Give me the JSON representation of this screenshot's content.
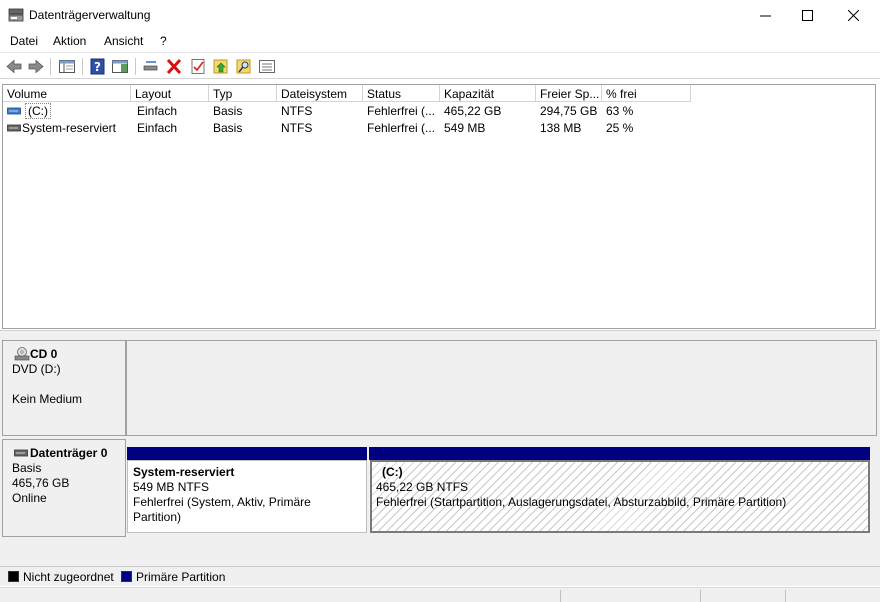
{
  "window": {
    "title": "Datenträgerverwaltung",
    "minimize_icon": "minimize-icon",
    "maximize_icon": "maximize-icon",
    "close_icon": "close-icon"
  },
  "menu": {
    "items": [
      "Datei",
      "Aktion",
      "Ansicht",
      "?"
    ]
  },
  "toolbar": {
    "icons": [
      "back-arrow-icon",
      "forward-arrow-icon",
      "console-tree-icon",
      "help-icon",
      "properties-pane-icon",
      "connect-disk-icon",
      "delete-icon",
      "checklist-icon",
      "folder-up-icon",
      "folder-search-icon",
      "list-view-icon"
    ]
  },
  "volume_table": {
    "columns": [
      "Volume",
      "Layout",
      "Typ",
      "Dateisystem",
      "Status",
      "Kapazität",
      "Freier Sp...",
      "% frei"
    ],
    "rows": [
      [
        "(C:)",
        "Einfach",
        "Basis",
        "NTFS",
        "Fehlerfrei (...",
        "465,22 GB",
        "294,75 GB",
        "63 %"
      ],
      [
        "System-reserviert",
        "Einfach",
        "Basis",
        "NTFS",
        "Fehlerfrei (...",
        "549 MB",
        "138 MB",
        "25 %"
      ]
    ]
  },
  "disks": {
    "cd0": {
      "title": "CD 0",
      "drive": "DVD (D:)",
      "media": "Kein Medium"
    },
    "disk0": {
      "title": "Datenträger 0",
      "type": "Basis",
      "size": "465,76 GB",
      "state": "Online",
      "partitions": [
        {
          "name": "System-reserviert",
          "size_fs": "549 MB NTFS",
          "status": "Fehlerfrei (System, Aktiv, Primäre Partition)"
        },
        {
          "name": "(C:)",
          "size_fs": "465,22 GB NTFS",
          "status": "Fehlerfrei (Startpartition, Auslagerungsdatei, Absturzabbild, Primäre Partition)"
        }
      ]
    }
  },
  "legend": {
    "unallocated": "Nicht zugeordnet",
    "primary": "Primäre Partition",
    "colors": {
      "unallocated": "#000000",
      "primary": "#000080"
    }
  }
}
